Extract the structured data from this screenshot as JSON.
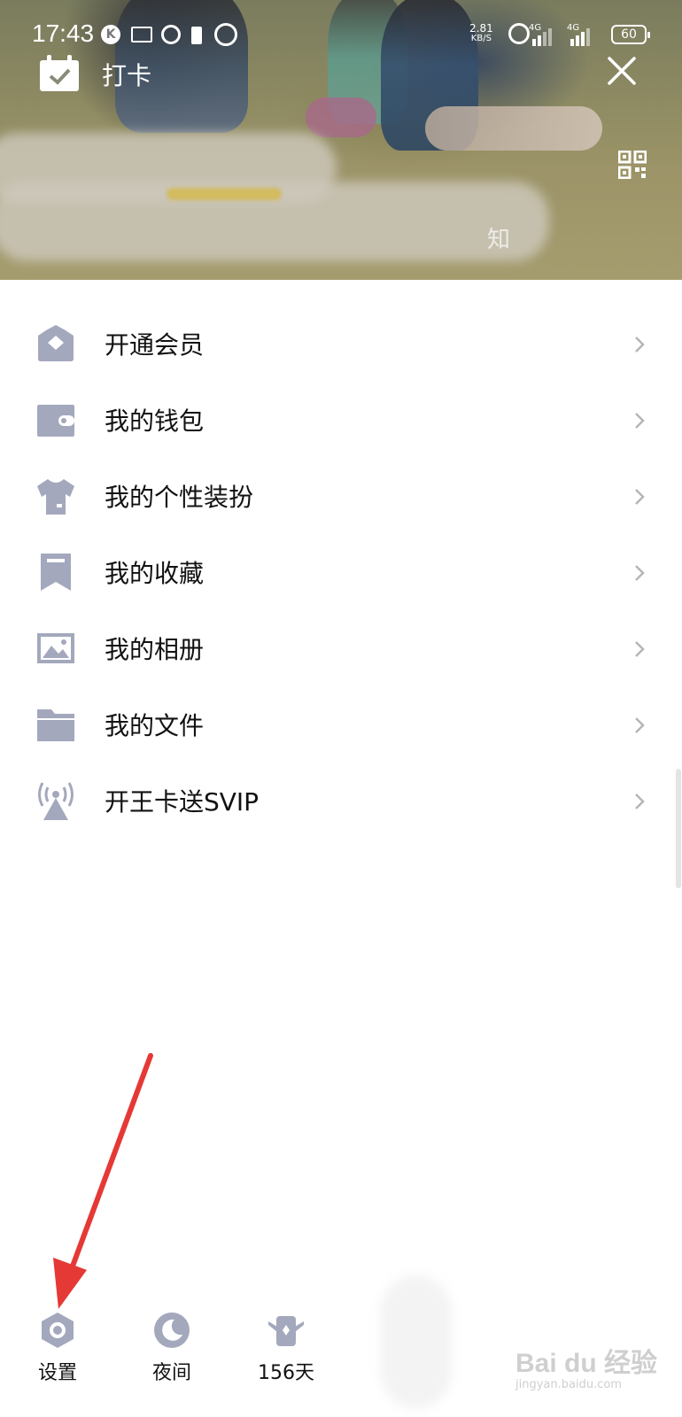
{
  "status_bar": {
    "time": "17:43",
    "net_speed_value": "2.81",
    "net_speed_unit": "KB/S",
    "signal1": "4G",
    "signal2": "4G",
    "battery": "60"
  },
  "header": {
    "checkin_label": "打卡",
    "blurred_text": "知"
  },
  "menu": {
    "items": [
      {
        "label": "开通会员",
        "icon": "crown-icon"
      },
      {
        "label": "我的钱包",
        "icon": "wallet-icon"
      },
      {
        "label": "我的个性装扮",
        "icon": "tshirt-icon"
      },
      {
        "label": "我的收藏",
        "icon": "bookmark-icon"
      },
      {
        "label": "我的相册",
        "icon": "photo-icon"
      },
      {
        "label": "我的文件",
        "icon": "folder-icon"
      },
      {
        "label": "开王卡送SVIP",
        "icon": "signal-tower-icon"
      }
    ]
  },
  "toolbar": {
    "settings_label": "设置",
    "night_label": "夜间",
    "days_label": "156天"
  },
  "watermark": {
    "logo": "Bai du 经验",
    "sub": "jingyan.baidu.com"
  },
  "colors": {
    "icon_gray": "#a3a8bd",
    "arrow_red": "#e53935"
  }
}
